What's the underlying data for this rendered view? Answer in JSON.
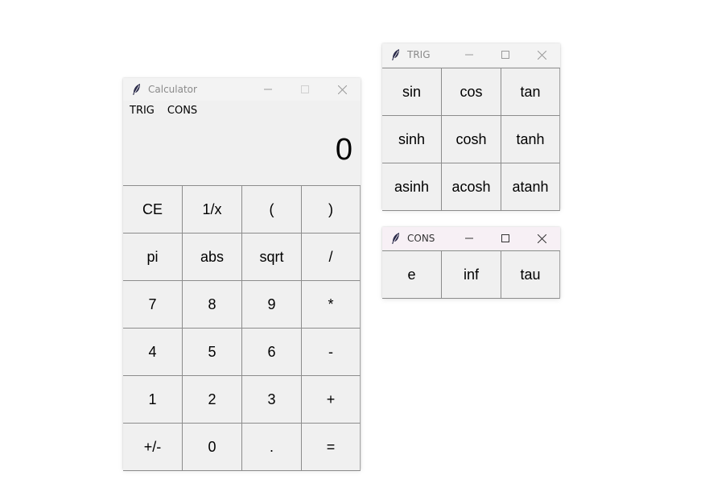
{
  "calculator": {
    "title": "Calculator",
    "menu": [
      "TRIG",
      "CONS"
    ],
    "display": "0",
    "buttons": [
      [
        "CE",
        "1/x",
        "(",
        ")"
      ],
      [
        "pi",
        "abs",
        "sqrt",
        "/"
      ],
      [
        "7",
        "8",
        "9",
        "*"
      ],
      [
        "4",
        "5",
        "6",
        "-"
      ],
      [
        "1",
        "2",
        "3",
        "+"
      ],
      [
        "+/-",
        "0",
        ".",
        "="
      ]
    ]
  },
  "trig": {
    "title": "TRIG",
    "buttons": [
      [
        "sin",
        "cos",
        "tan"
      ],
      [
        "sinh",
        "cosh",
        "tanh"
      ],
      [
        "asinh",
        "acosh",
        "atanh"
      ]
    ]
  },
  "cons": {
    "title": "CONS",
    "buttons": [
      [
        "e",
        "inf",
        "tau"
      ]
    ]
  },
  "icons": {
    "app": "feather-icon",
    "minimize": "minimize-icon",
    "maximize": "maximize-icon",
    "close": "close-icon"
  }
}
